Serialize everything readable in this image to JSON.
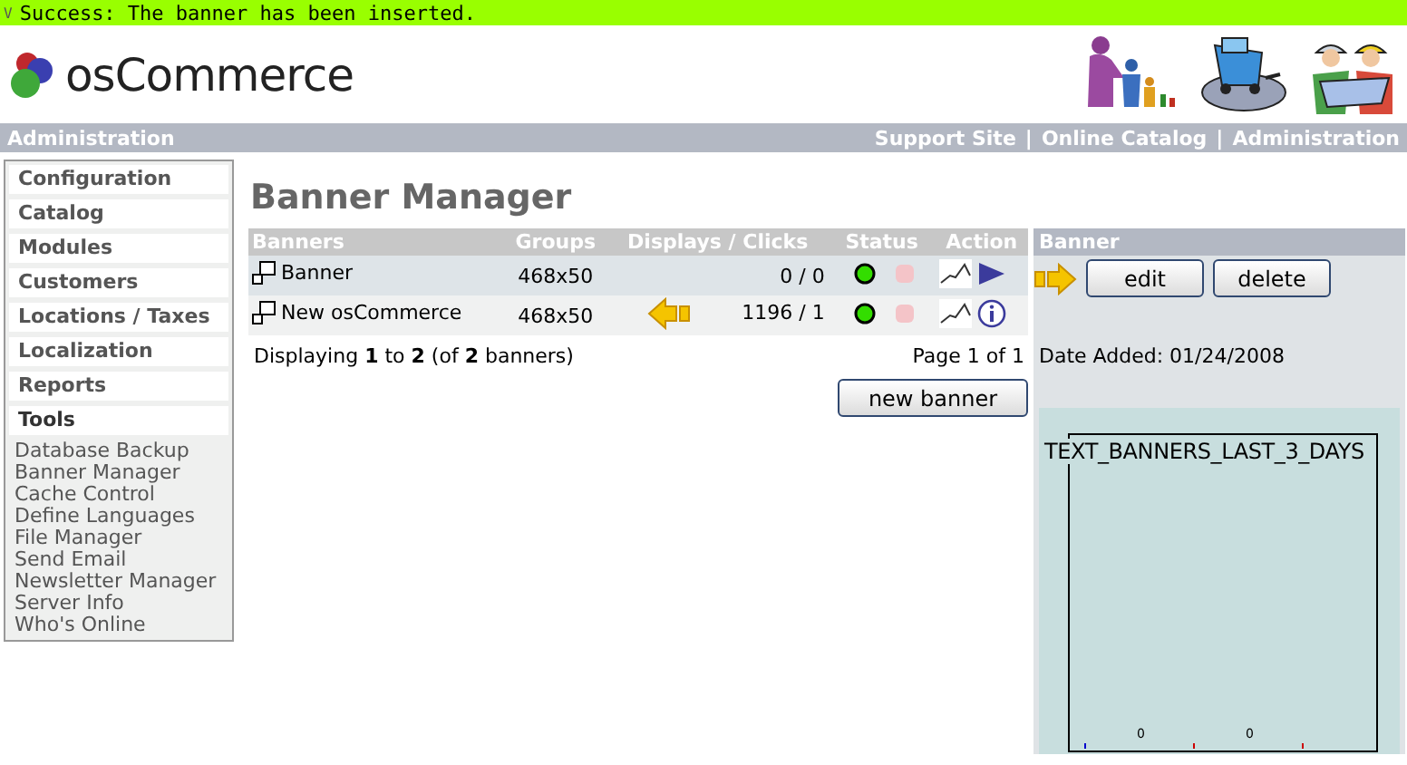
{
  "message": {
    "icon": "V",
    "text": "Success: The banner has been inserted."
  },
  "logo": {
    "text": "osCommerce"
  },
  "nav": {
    "left": "Administration",
    "links": [
      "Support Site",
      "Online Catalog",
      "Administration"
    ],
    "separator": "|"
  },
  "sidebar": {
    "sections": [
      {
        "label": "Configuration",
        "expanded": false
      },
      {
        "label": "Catalog",
        "expanded": false
      },
      {
        "label": "Modules",
        "expanded": false
      },
      {
        "label": "Customers",
        "expanded": false
      },
      {
        "label": "Locations / Taxes",
        "expanded": false
      },
      {
        "label": "Localization",
        "expanded": false
      },
      {
        "label": "Reports",
        "expanded": false
      },
      {
        "label": "Tools",
        "expanded": true,
        "children": [
          "Database Backup",
          "Banner Manager",
          "Cache Control",
          "Define Languages",
          "File Manager",
          "Send Email",
          "Newsletter Manager",
          "Server Info",
          "Who's Online"
        ]
      }
    ]
  },
  "page_title": "Banner Manager",
  "table": {
    "columns": [
      "Banners",
      "Groups",
      "Displays / Clicks",
      "Status",
      "Action"
    ],
    "rows": [
      {
        "name": "Banner",
        "group": "468x50",
        "displays_clicks": "0 / 0",
        "active": true,
        "marker": false,
        "selected": true
      },
      {
        "name": "New osCommerce",
        "group": "468x50",
        "displays_clicks": "1196 / 1",
        "active": true,
        "marker": true,
        "selected": false
      }
    ],
    "summary": "Displaying **1** to **2** (of **2** banners)",
    "page": "Page 1 of 1",
    "new_button": "new banner"
  },
  "info_panel": {
    "heading": "Banner",
    "buttons": [
      "edit",
      "delete"
    ],
    "date_added": "Date Added: 01/24/2008",
    "graph": {
      "title": "TEXT_BANNERS_LAST_3_DAYS",
      "value_labels": [
        "0",
        "0"
      ]
    }
  }
}
